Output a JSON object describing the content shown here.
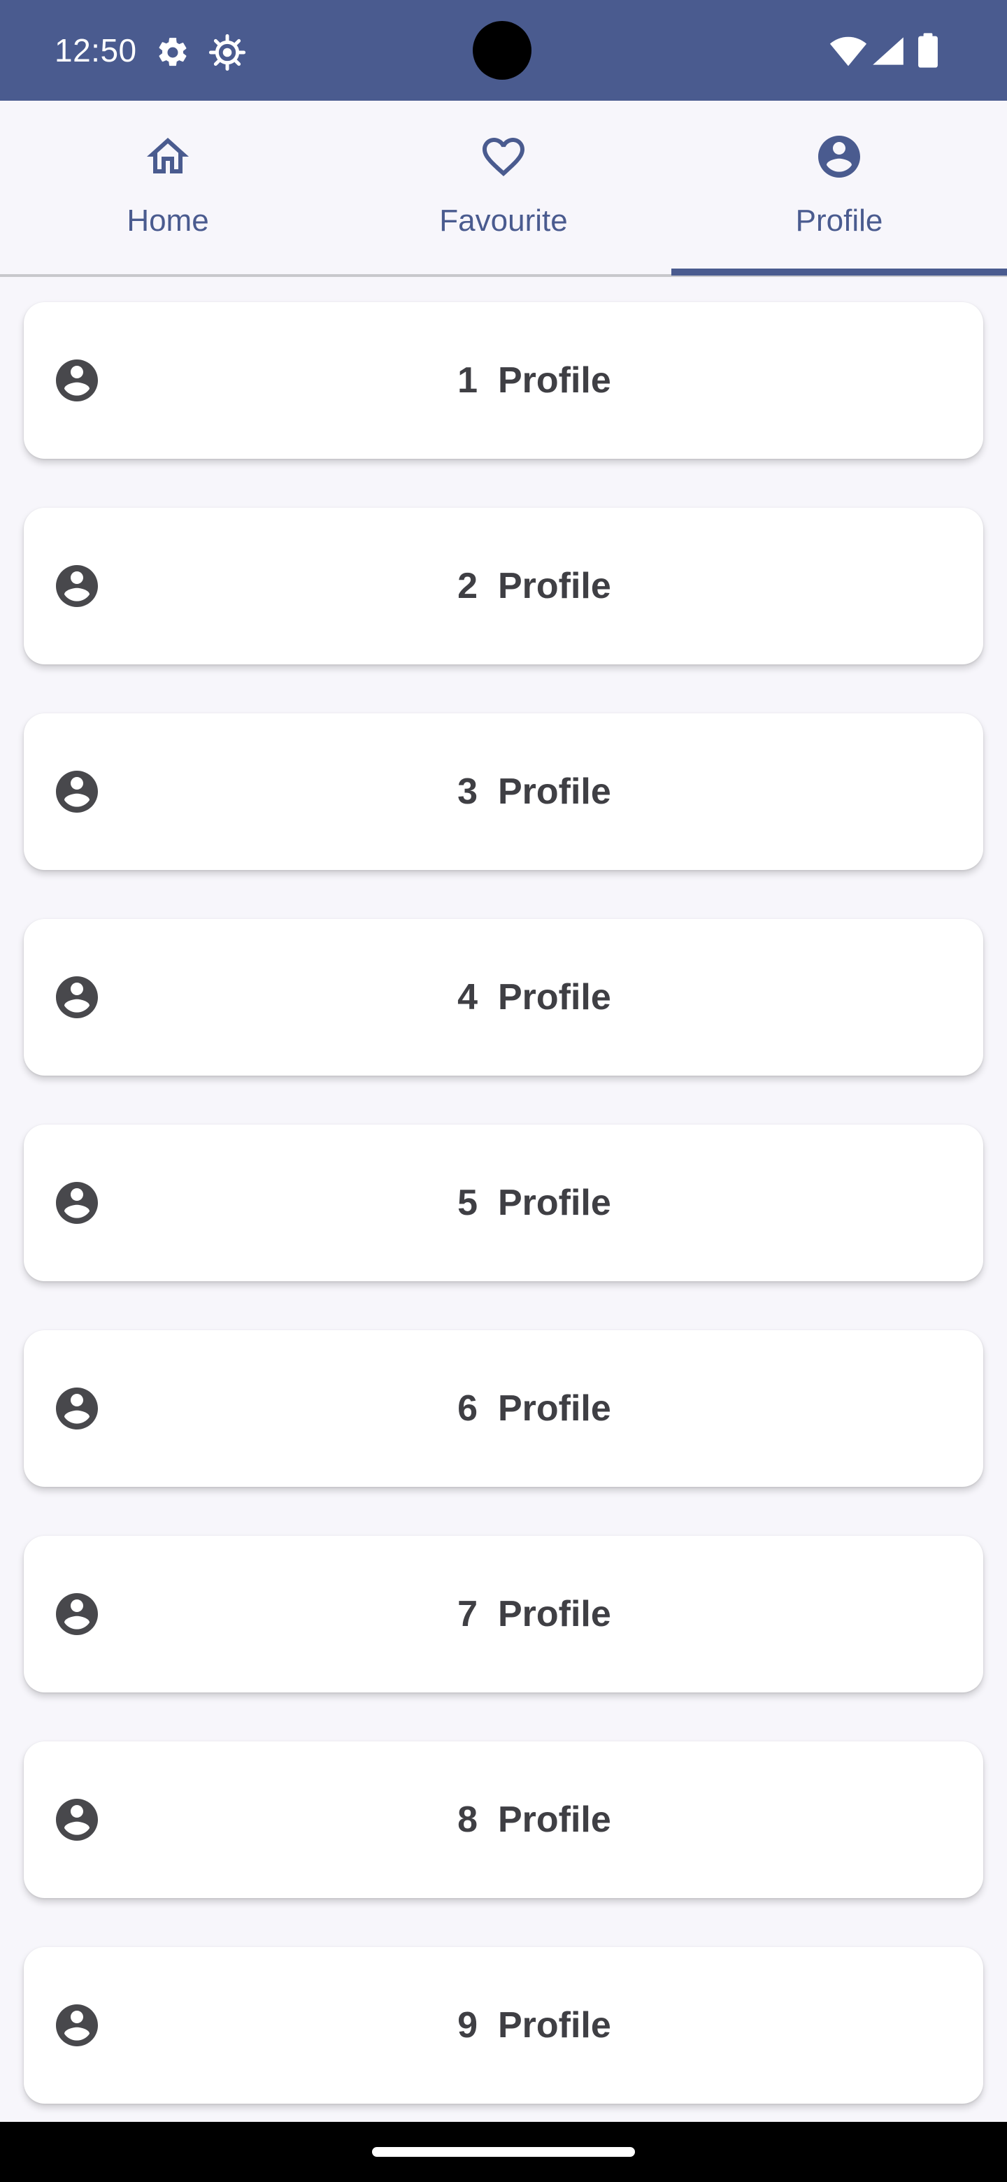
{
  "status_bar": {
    "time": "12:50",
    "icons": [
      "settings-icon",
      "debug-icon",
      "wifi-icon",
      "cell-signal-icon",
      "battery-icon"
    ]
  },
  "tabs": [
    {
      "label": "Home",
      "icon": "home-icon",
      "selected": false
    },
    {
      "label": "Favourite",
      "icon": "heart-icon",
      "selected": false
    },
    {
      "label": "Profile",
      "icon": "account-circle-icon",
      "selected": true
    }
  ],
  "profiles": [
    {
      "title": "1  Profile",
      "icon": "account-circle-icon"
    },
    {
      "title": "2  Profile",
      "icon": "account-circle-icon"
    },
    {
      "title": "3  Profile",
      "icon": "account-circle-icon"
    },
    {
      "title": "4  Profile",
      "icon": "account-circle-icon"
    },
    {
      "title": "5  Profile",
      "icon": "account-circle-icon"
    },
    {
      "title": "6  Profile",
      "icon": "account-circle-icon"
    },
    {
      "title": "7  Profile",
      "icon": "account-circle-icon"
    },
    {
      "title": "8  Profile",
      "icon": "account-circle-icon"
    },
    {
      "title": "9  Profile",
      "icon": "account-circle-icon"
    }
  ],
  "colors": {
    "primary": "#4a5b8f",
    "background": "#f7f6fb",
    "card": "#ffffff",
    "text": "#3f3f44"
  }
}
